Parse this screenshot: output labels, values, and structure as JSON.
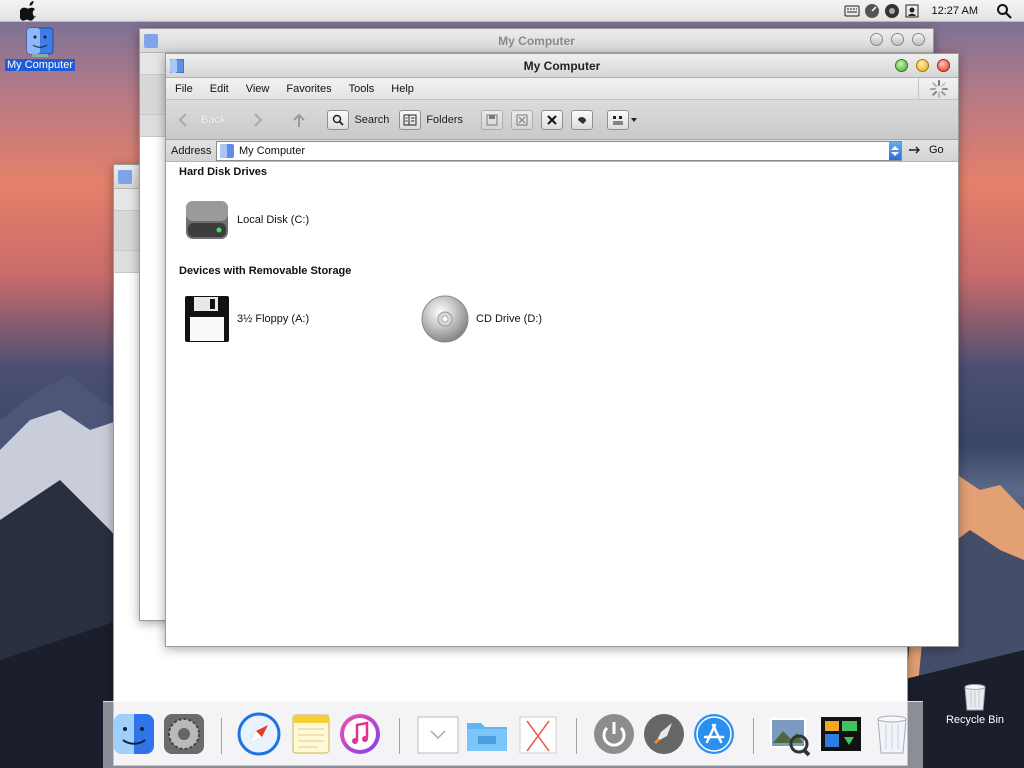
{
  "menubar": {
    "clock": "12:27 AM"
  },
  "desktop": {
    "my_computer_label": "My Computer",
    "recycle_bin_label": "Recycle Bin"
  },
  "background_windows": [
    {
      "title": "My Computer"
    }
  ],
  "window": {
    "title": "My Computer",
    "menu": [
      "File",
      "Edit",
      "View",
      "Favorites",
      "Tools",
      "Help"
    ],
    "toolbar": {
      "back": "Back",
      "search": "Search",
      "folders": "Folders"
    },
    "address": {
      "label": "Address",
      "value": "My Computer",
      "go": "Go"
    },
    "groups": [
      {
        "title": "Hard Disk Drives",
        "items": [
          {
            "label": "Local Disk (C:)"
          }
        ]
      },
      {
        "title": "Devices with Removable Storage",
        "items": [
          {
            "label": "3½ Floppy (A:)"
          },
          {
            "label": "CD Drive (D:)"
          }
        ]
      }
    ]
  },
  "colors": {
    "selection": "#1f5bd6",
    "dropdown": "#2d6fd2",
    "close": "#d83a23",
    "minimize": "#e2a20f",
    "zoom": "#3ea52a"
  },
  "icons": [
    "apple-icon",
    "keyboard-icon",
    "dashboard-icon",
    "network-icon",
    "user-icon",
    "spotlight-icon",
    "finder-icon",
    "system-preferences-icon",
    "safari-icon",
    "notes-icon",
    "itunes-icon",
    "downloads-stack-icon",
    "folder-icon",
    "x-app-icon",
    "power-icon",
    "rocket-icon",
    "app-store-icon",
    "preview-icon",
    "photo-icon",
    "trash-icon"
  ]
}
